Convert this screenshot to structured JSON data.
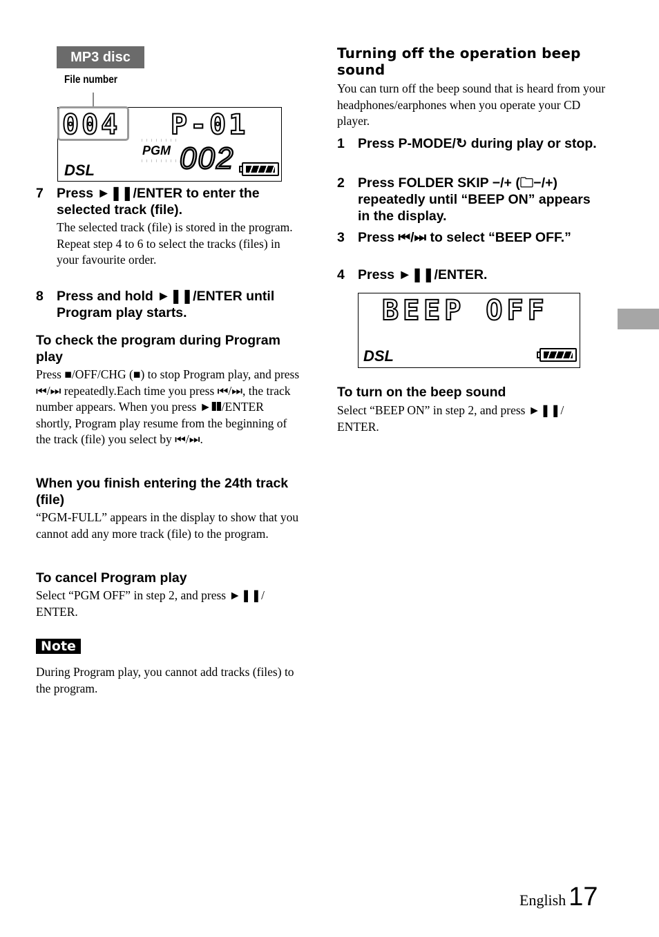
{
  "left_column": {
    "mp3_tag": "MP3 disc",
    "file_number_label": "File number",
    "display1": {
      "file_number": "004",
      "program_slot": "P-01",
      "pgm_indicator": "PGM",
      "track_number": "002",
      "dsl_label": "DSL",
      "battery_icon": "battery-full-icon"
    },
    "step7": {
      "number": "7",
      "instruction": "Press ►❚❚/ENTER to enter the selected track (file).",
      "body_lines": [
        "The selected track (file) is stored in the program.",
        "Repeat step 4 to 6 to select the tracks (files) in your favourite order."
      ]
    },
    "step8": {
      "number": "8",
      "instruction": "Press and hold ►❚❚/ENTER until Program play starts."
    },
    "check_program": {
      "heading": "To check the program during Program play",
      "body": "Press ■/OFF/CHG (■) to stop Program play, and press ⏮/⏭ repeatedly.Each time you press ⏮/⏭, the track number appears. When you press ►❚❚/ENTER shortly, Program play resume from the beginning of the track (file) you select by ⏮/⏭."
    },
    "finish_24th": {
      "heading": "When you finish entering the 24th track (file)",
      "body": "“PGM-FULL” appears in the display to show that you cannot add any more track (file) to the program."
    },
    "cancel_program": {
      "heading": "To cancel Program play",
      "body": "Select “PGM OFF” in step 2, and press ►❚❚/ ENTER."
    },
    "note": {
      "label": "Note",
      "body": "During Program play, you cannot add tracks (files) to the program."
    }
  },
  "right_column": {
    "heading": "Turning off the operation beep sound",
    "intro": "You can turn off the beep sound that is heard from your headphones/earphones when you operate your CD player.",
    "steps": [
      {
        "number": "1",
        "text": "Press P-MODE/↻ during play or stop."
      },
      {
        "number": "2",
        "text": "Press FOLDER SKIP −/+ (🗀−/+) repeatedly until “BEEP ON” appears in the display."
      },
      {
        "number": "3",
        "text": "Press ⏮/⏭ to select “BEEP OFF.”"
      },
      {
        "number": "4",
        "text": "Press ►❚❚/ENTER."
      }
    ],
    "display2": {
      "text": "BEEP OFF",
      "dsl_label": "DSL",
      "battery_icon": "battery-full-icon"
    },
    "turn_on": {
      "heading": "To turn on the beep sound",
      "body": "Select “BEEP ON” in step 2, and press ►❚❚/ ENTER."
    }
  },
  "footer": {
    "language": "English",
    "page_number": "17"
  },
  "colors": {
    "tag_gray": "#6b6b6b",
    "side_tab_gray": "#a6a6a6",
    "highlight_gray": "#999999"
  }
}
